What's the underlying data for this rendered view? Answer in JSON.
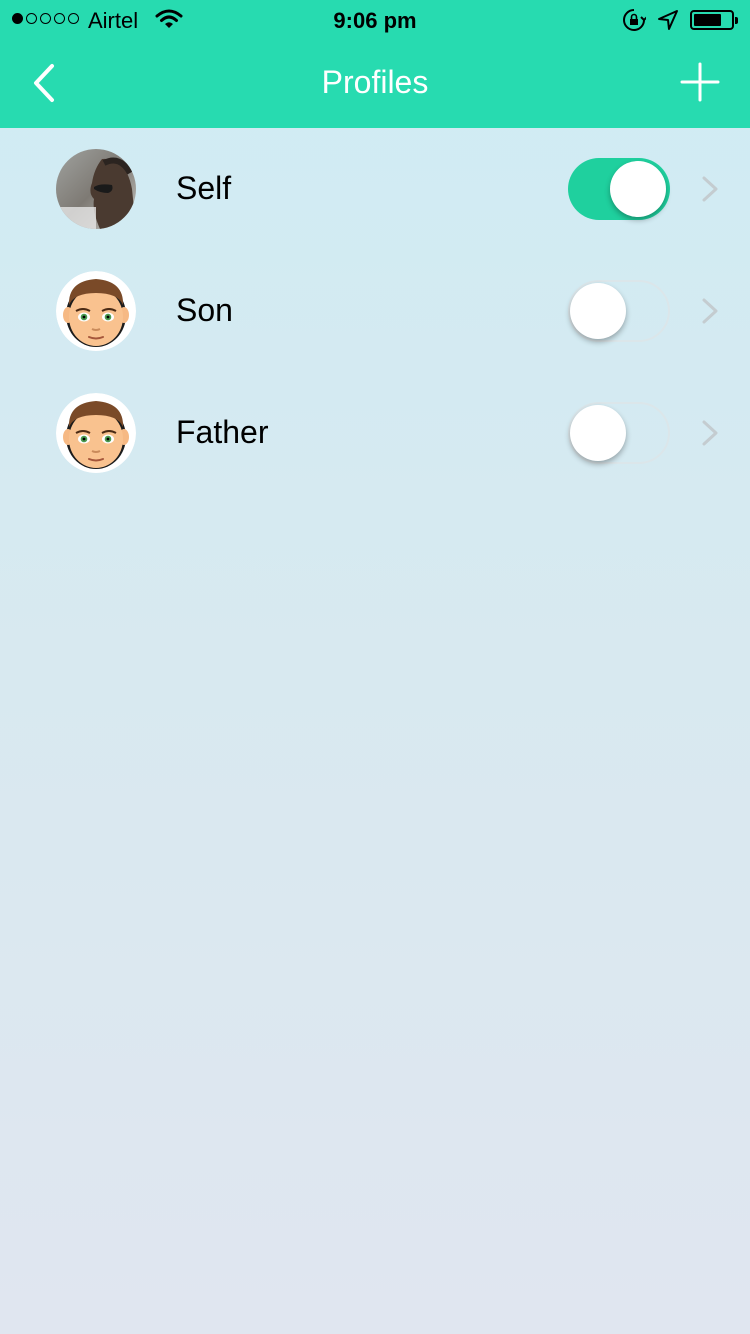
{
  "status_bar": {
    "signal_filled": 1,
    "signal_total": 5,
    "carrier": "Airtel",
    "time": "9:06 pm",
    "battery_level": 0.75
  },
  "nav": {
    "title": "Profiles",
    "back_icon": "chevron-left-icon",
    "add_icon": "plus-icon"
  },
  "colors": {
    "header": "#27dbb0",
    "toggle_on": "#1fd09e",
    "chevron": "#c4ccd0"
  },
  "profiles": [
    {
      "name": "Self",
      "avatar": "photo-avatar",
      "enabled": true
    },
    {
      "name": "Son",
      "avatar": "cartoon-man-avatar",
      "enabled": false
    },
    {
      "name": "Father",
      "avatar": "cartoon-man-avatar",
      "enabled": false
    }
  ]
}
